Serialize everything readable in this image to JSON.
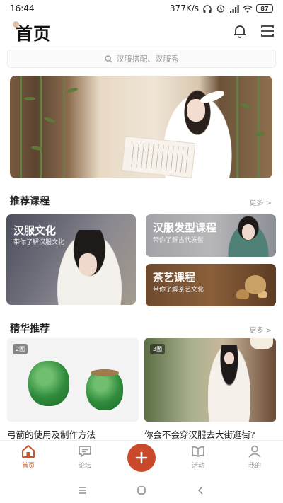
{
  "status_bar": {
    "time": "16:44",
    "network_speed": "377K/s",
    "battery": "87"
  },
  "header": {
    "title": "首页"
  },
  "search": {
    "placeholder": "汉服搭配、汉服秀"
  },
  "sections": {
    "recommended": {
      "title": "推荐课程",
      "more": "更多 >"
    },
    "featured": {
      "title": "精华推荐",
      "more": "更多 >"
    }
  },
  "courses": [
    {
      "title": "汉服文化",
      "subtitle": "带你了解汉服文化"
    },
    {
      "title": "汉服发型课程",
      "subtitle": "带你了解古代发髻"
    },
    {
      "title": "茶艺课程",
      "subtitle": "带你了解茶艺文化"
    }
  ],
  "featured": [
    {
      "badge": "2图",
      "caption": "弓箭的使用及制作方法"
    },
    {
      "badge": "3图",
      "caption": "你会不会穿汉服去大街逛街?"
    }
  ],
  "bottom_nav": [
    {
      "label": "首页"
    },
    {
      "label": "论坛"
    },
    {
      "label": "活动"
    },
    {
      "label": "我的"
    }
  ],
  "colors": {
    "accent": "#c9492a",
    "active_tab": "#c8552d"
  },
  "icons": [
    "headphones-icon",
    "alarm-icon",
    "signal-icon",
    "wifi-icon",
    "bell-icon",
    "menu-icon",
    "search-icon",
    "home-icon",
    "forum-icon",
    "add-icon",
    "activity-icon",
    "profile-icon"
  ]
}
